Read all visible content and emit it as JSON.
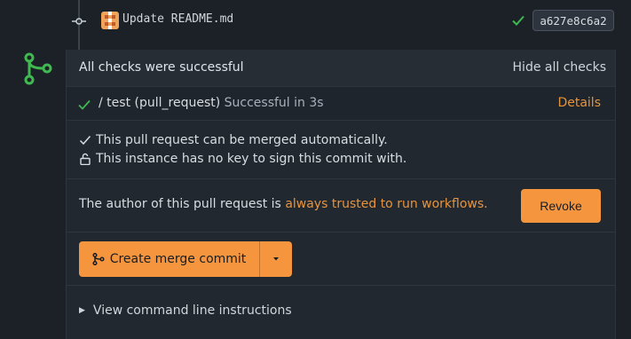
{
  "commit": {
    "message": "Update README.md",
    "sha": "a627e8c6a2",
    "status_color": "#3fb950"
  },
  "checks": {
    "header_title": "All checks were successful",
    "hide_label": "Hide all checks",
    "items": [
      {
        "name": "/ test (pull_request)",
        "status": "Successful in 3s",
        "details_label": "Details"
      }
    ]
  },
  "merge_info": {
    "can_merge": "This pull request can be merged automatically.",
    "no_key": "This instance has no key to sign this commit with."
  },
  "author": {
    "text": "The author of this pull request is",
    "link": "always trusted to run workflows.",
    "revoke_label": "Revoke"
  },
  "merge_button": {
    "label": "Create merge commit"
  },
  "cli": {
    "label": "View command line instructions"
  },
  "colors": {
    "accent": "#f5963f",
    "link": "#e8943c",
    "success": "#3fb950",
    "background": "#1c2128",
    "panel": "#22282f"
  },
  "icons": {
    "commit": "git-commit-icon",
    "merge": "git-merge-icon",
    "check": "check-icon",
    "lock": "unlock-icon",
    "caret": "caret-down-icon"
  }
}
